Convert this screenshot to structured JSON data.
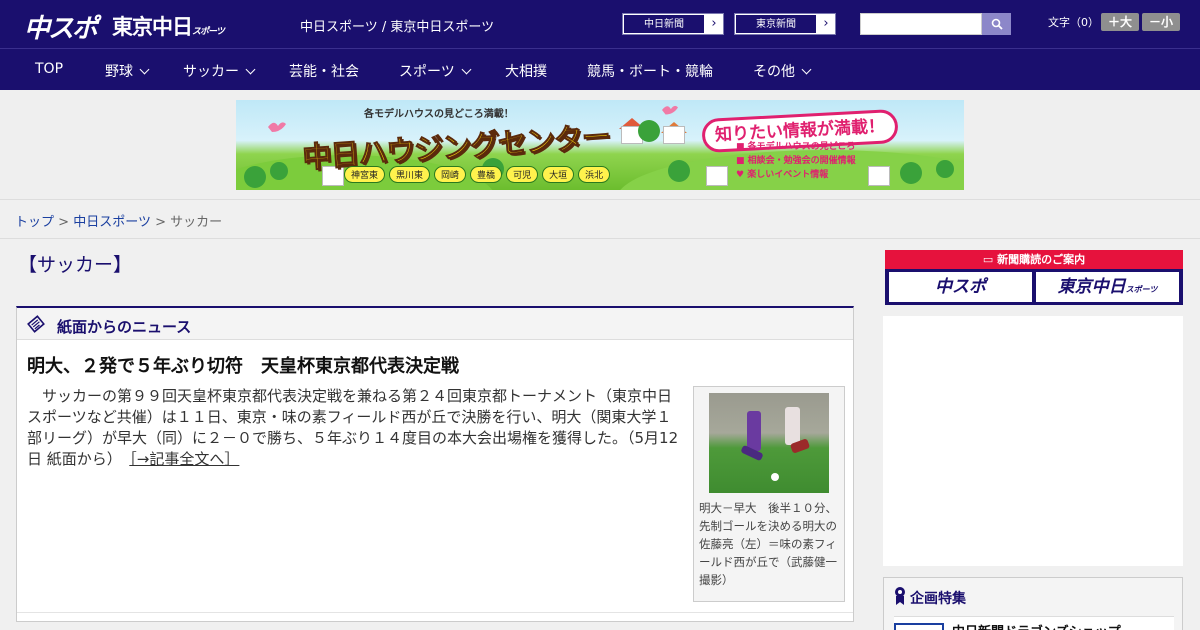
{
  "header": {
    "logo_chuspo": "中スポ",
    "logo_tokyo": "東京中日",
    "logo_tokyo_sub": "スポーツ",
    "site_title": "中日スポーツ / 東京中日スポーツ",
    "paper_links": [
      {
        "label": "中日新聞",
        "arrow": "›"
      },
      {
        "label": "東京新聞",
        "arrow": "›"
      }
    ],
    "search": {
      "value": "",
      "placeholder": ""
    },
    "font_size_label": "文字（0）",
    "font_size_up": "＋大",
    "font_size_down": "－小"
  },
  "nav": {
    "items": [
      {
        "label": "TOP",
        "has_dropdown": false
      },
      {
        "label": "野球",
        "has_dropdown": true
      },
      {
        "label": "サッカー",
        "has_dropdown": true
      },
      {
        "label": "芸能・社会",
        "has_dropdown": false
      },
      {
        "label": "スポーツ",
        "has_dropdown": true
      },
      {
        "label": "大相撲",
        "has_dropdown": false
      },
      {
        "label": "競馬・ボート・競輪",
        "has_dropdown": false
      },
      {
        "label": "その他",
        "has_dropdown": true
      }
    ]
  },
  "banner": {
    "tagline": "各モデルハウスの見どころ満載！",
    "headline": "中日ハウジングセンター",
    "bubble": "知りたい情報が満載！",
    "cities": [
      "神宮東",
      "黒川東",
      "岡崎",
      "豊橋",
      "可児",
      "大垣",
      "浜北"
    ],
    "info": [
      "各モデルハウスの見どころ",
      "相談会・勉強会の開催情報",
      "楽しいイベント情報"
    ]
  },
  "breadcrumb": {
    "top": "トップ",
    "section": "中日スポーツ",
    "current": "サッカー",
    "separator": ">"
  },
  "page_title": "【サッカー】",
  "news_panel": {
    "header": "紙面からのニュース",
    "article": {
      "title": "明大、２発で５年ぶり切符　天皇杯東京都代表決定戦",
      "body": "サッカーの第９９回天皇杯東京都代表決定戦を兼ねる第２４回東京都トーナメント（東京中日スポーツなど共催）は１１日、東京・味の素フィールド西が丘で決勝を行い、明大（関東大学１部リーグ）が早大（同）に２－０で勝ち、５年ぶり１４度目の本大会出場権を獲得した。（5月12日 紙面から）",
      "read_more": "［→記事全文へ］",
      "photo_caption": "明大－早大　後半１０分、先制ゴールを決める明大の佐藤亮（左）＝味の素フィールド西が丘で（武藤健一撮影）"
    }
  },
  "sidebar": {
    "subscribe_header": "新聞購読のご案内",
    "subscribe_buttons": [
      "中スポ",
      "東京中日"
    ],
    "subscribe_sub": "スポーツ",
    "feature_header": "企画特集",
    "feature_item": "中日新聞ドラゴンズショップ"
  },
  "colors": {
    "brand_navy": "#1a0f6e",
    "accent_red": "#e6123d",
    "link_blue": "#1a3fa0"
  }
}
